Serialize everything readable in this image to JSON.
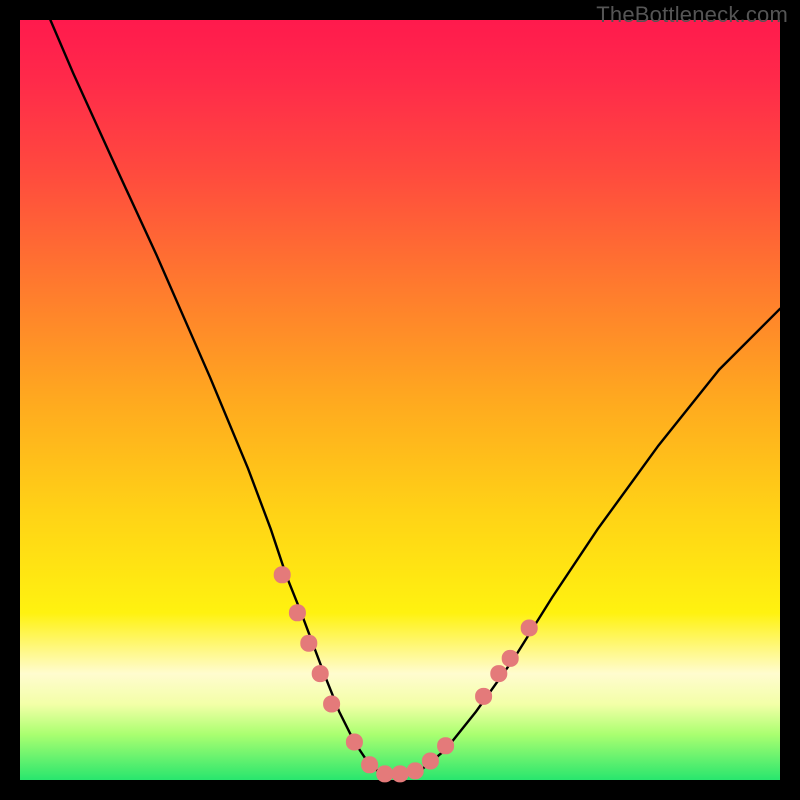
{
  "watermark": "TheBottleneck.com",
  "chart_data": {
    "type": "line",
    "title": "",
    "xlabel": "",
    "ylabel": "",
    "xlim": [
      0,
      100
    ],
    "ylim": [
      0,
      100
    ],
    "series": [
      {
        "name": "bottleneck-curve",
        "x": [
          4,
          7,
          12,
          18,
          25,
          30,
          33,
          35,
          37,
          40,
          42,
          44,
          46,
          48,
          50,
          53,
          56,
          60,
          65,
          70,
          76,
          84,
          92,
          100
        ],
        "values": [
          100,
          93,
          82,
          69,
          53,
          41,
          33,
          27,
          22,
          14,
          9,
          5,
          2,
          0.5,
          0.5,
          1.5,
          4,
          9,
          16,
          24,
          33,
          44,
          54,
          62
        ]
      }
    ],
    "markers": {
      "name": "highlighted-points",
      "color": "#e47a7a",
      "points": [
        {
          "x": 34.5,
          "y": 27
        },
        {
          "x": 36.5,
          "y": 22
        },
        {
          "x": 38,
          "y": 18
        },
        {
          "x": 39.5,
          "y": 14
        },
        {
          "x": 41,
          "y": 10
        },
        {
          "x": 44,
          "y": 5
        },
        {
          "x": 46,
          "y": 2
        },
        {
          "x": 48,
          "y": 0.8
        },
        {
          "x": 50,
          "y": 0.8
        },
        {
          "x": 52,
          "y": 1.2
        },
        {
          "x": 54,
          "y": 2.5
        },
        {
          "x": 56,
          "y": 4.5
        },
        {
          "x": 61,
          "y": 11
        },
        {
          "x": 63,
          "y": 14
        },
        {
          "x": 64.5,
          "y": 16
        },
        {
          "x": 67,
          "y": 20
        }
      ]
    },
    "gradient_zones": [
      {
        "label": "severe-bottleneck",
        "color": "#ff1a4d",
        "position": "top"
      },
      {
        "label": "moderate-bottleneck",
        "color": "#ffb020",
        "position": "middle"
      },
      {
        "label": "optimal",
        "color": "#28e66e",
        "position": "bottom"
      }
    ]
  }
}
